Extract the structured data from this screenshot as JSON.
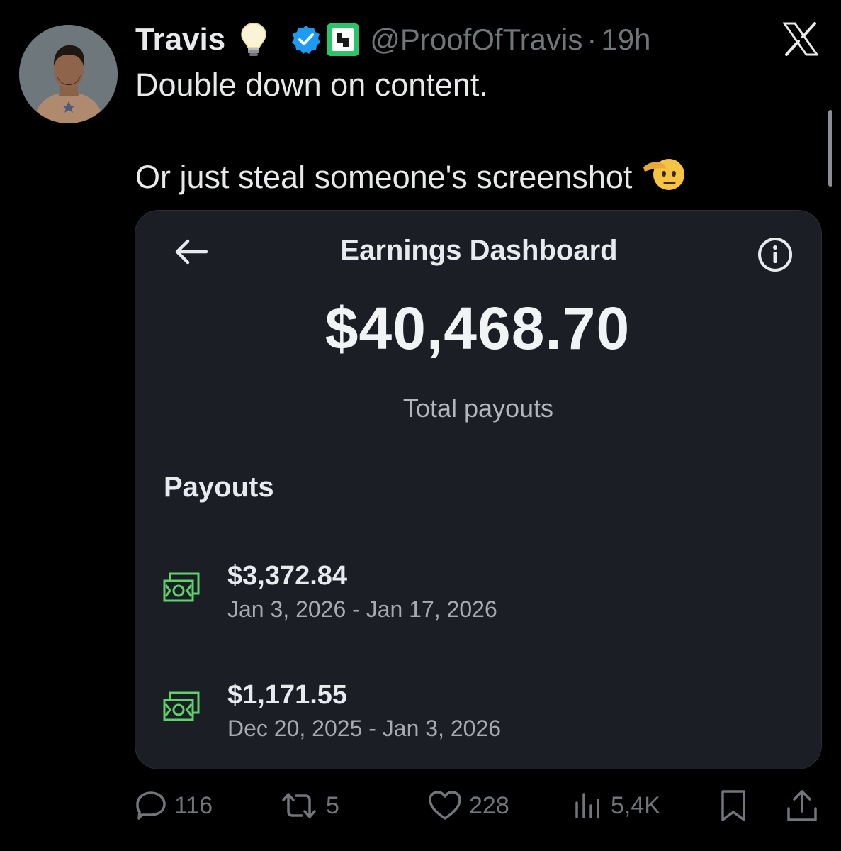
{
  "author": {
    "display_name": "Travis",
    "handle": "@ProofOfTravis",
    "separator": "·",
    "timestamp": "19h"
  },
  "tweet": {
    "line1": "Double down on content.",
    "line2": "Or just steal someone's screenshot"
  },
  "card": {
    "title": "Earnings Dashboard",
    "total_amount": "$40,468.70",
    "total_label": "Total payouts",
    "section_heading": "Payouts",
    "payouts": [
      {
        "amount": "$3,372.84",
        "range": "Jan 3, 2026 - Jan 17, 2026"
      },
      {
        "amount": "$1,171.55",
        "range": "Dec 20, 2025 - Jan 3, 2026"
      }
    ]
  },
  "actions": {
    "replies": "116",
    "reposts": "5",
    "likes": "228",
    "views": "5,4K"
  },
  "icons": {
    "header": [
      "lightbulb-icon",
      "verified-badge-icon",
      "affiliate-badge-icon"
    ],
    "logo": "x-logo-icon",
    "emoji": "saluting-face-icon",
    "card": [
      "back-arrow-icon",
      "info-icon",
      "money-icon"
    ],
    "actions": [
      "reply-icon",
      "repost-icon",
      "like-icon",
      "views-icon",
      "bookmark-icon",
      "share-icon"
    ]
  },
  "colors": {
    "background": "#000000",
    "card": "#1b1e25",
    "verified": "#1d9bf0",
    "affiliate": "#2bc46a",
    "money": "#5fd26a",
    "muted_text": "#71767b"
  }
}
